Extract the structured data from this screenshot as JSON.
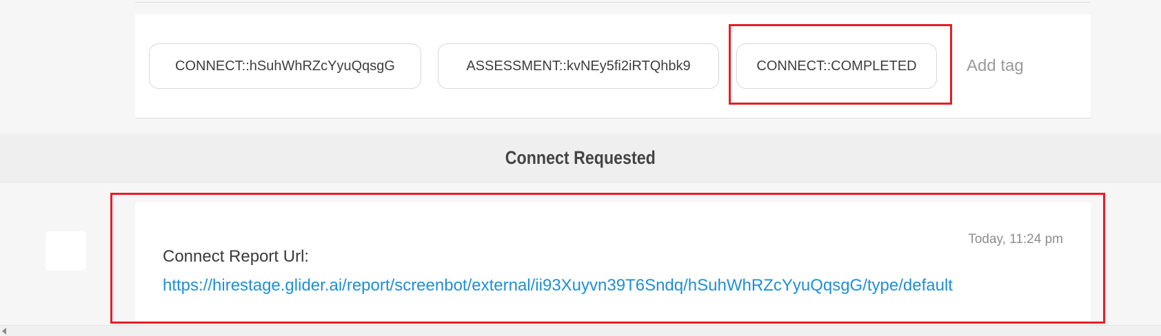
{
  "tags": {
    "items": [
      {
        "label": "CONNECT::hSuhWhRZcYyuQqsgG"
      },
      {
        "label": "ASSESSMENT::kvNEy5fi2iRTQhbk9"
      },
      {
        "label": "CONNECT::COMPLETED"
      }
    ],
    "add_tag_placeholder": "Add tag"
  },
  "section": {
    "title": "Connect Requested"
  },
  "message": {
    "timestamp": "Today, 11:24 pm",
    "label": "Connect Report Url:",
    "link": "https://hirestage.glider.ai/report/screenbot/external/ii93Xuyvn39T6Sndq/hSuhWhRZcYyuQqsgG/type/default"
  },
  "colors": {
    "highlight": "#ea1b22",
    "link": "#1e8fd8"
  },
  "icons": {
    "scroll_left": "triangle-left-icon"
  }
}
